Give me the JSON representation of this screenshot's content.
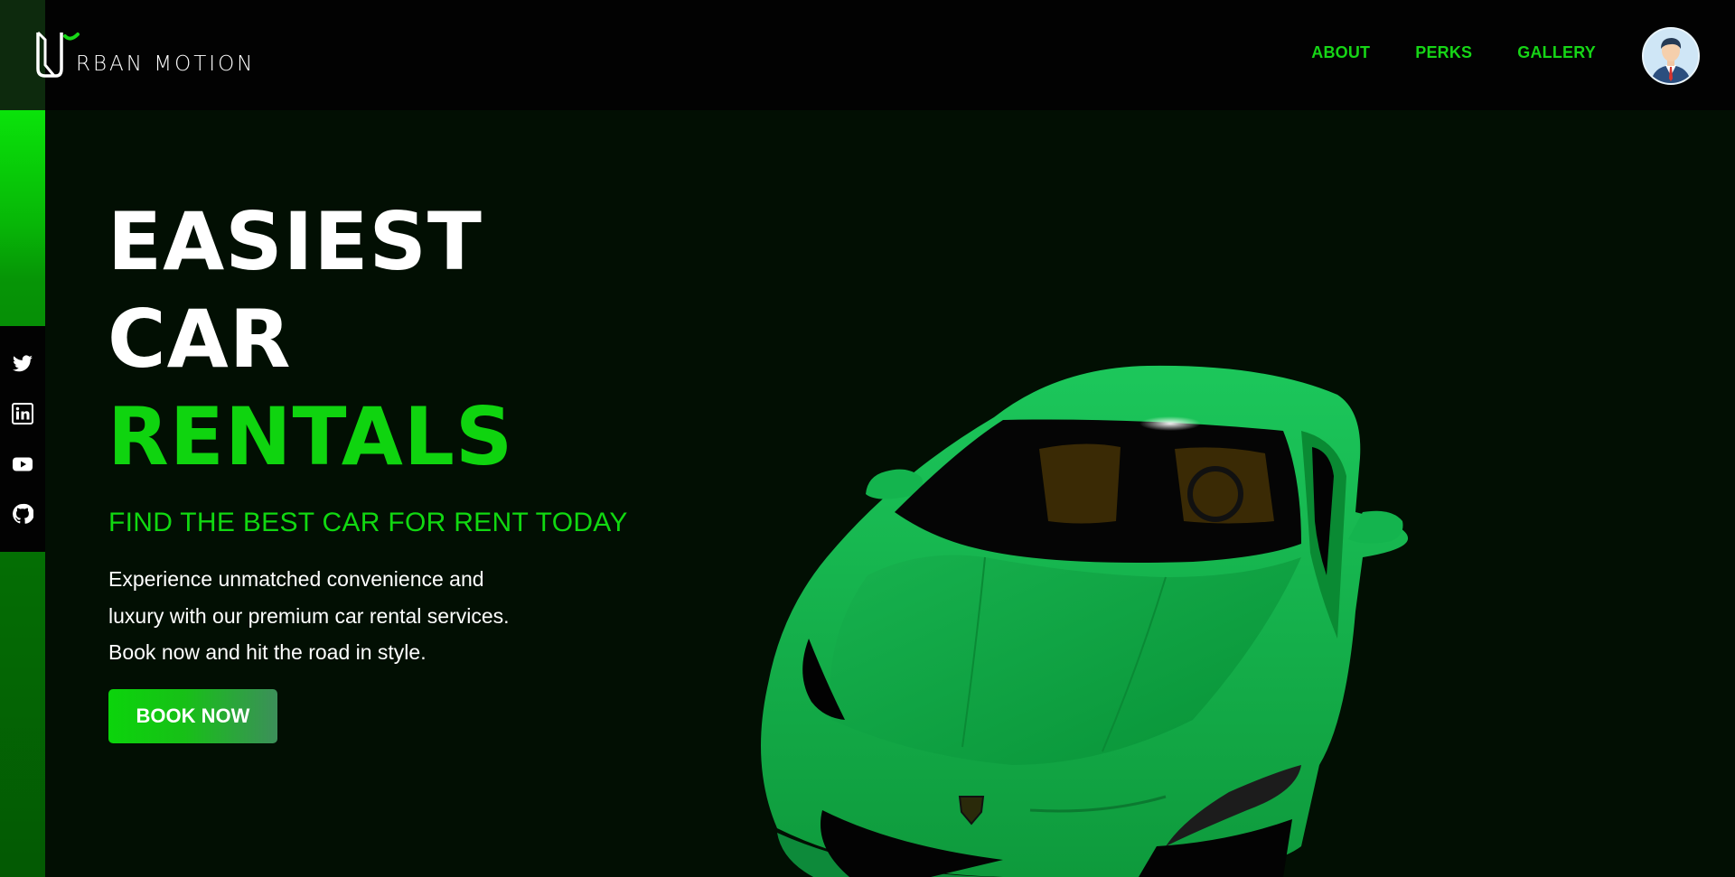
{
  "brand": {
    "logo_text": "RBAN MOTION"
  },
  "nav": {
    "items": [
      "ABOUT",
      "PERKS",
      "GALLERY"
    ]
  },
  "social": {
    "icons": [
      "twitter-icon",
      "linkedin-icon",
      "youtube-icon",
      "github-icon"
    ]
  },
  "hero": {
    "title_line1": "EASIEST",
    "title_line2": "CAR",
    "title_line3": "RENTALS",
    "subtitle": "FIND THE BEST CAR FOR RENT TODAY",
    "desc_line1": "Experience unmatched convenience and",
    "desc_line2": "luxury with our premium car rental services.",
    "desc_line3": "Book now and hit the road in style.",
    "cta_label": "BOOK NOW"
  },
  "colors": {
    "accent": "#0fd40f",
    "background": "#020f03",
    "header": "#020202",
    "car": "#12a844"
  }
}
